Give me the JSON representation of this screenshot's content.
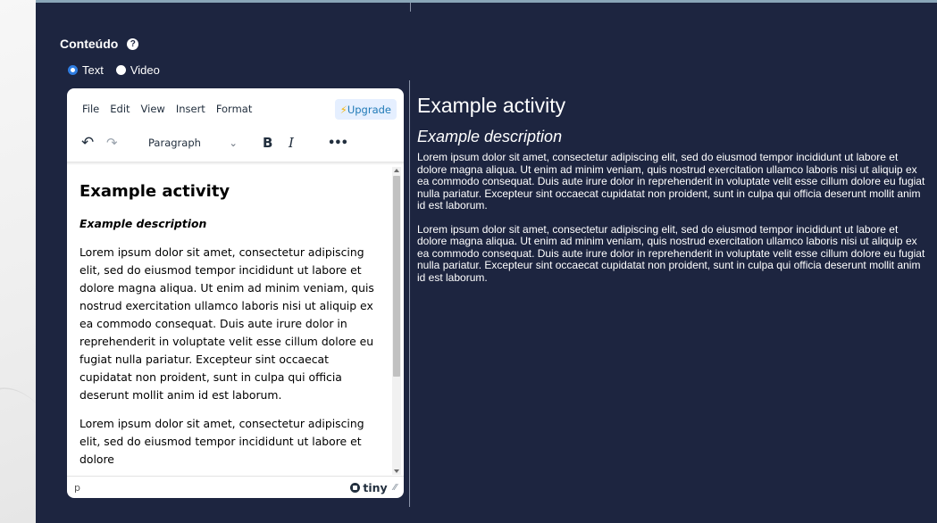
{
  "section": {
    "label": "Conteúdo",
    "help_icon": "question-circle-icon"
  },
  "content_type": {
    "options": [
      "Text",
      "Video"
    ],
    "selected": "Text"
  },
  "editor": {
    "menu": [
      "File",
      "Edit",
      "View",
      "Insert",
      "Format"
    ],
    "upgrade_label": "Upgrade",
    "block_format": "Paragraph",
    "bold_label": "B",
    "italic_label": "I",
    "more_label": "•••",
    "heading": "Example activity",
    "description": "Example description",
    "paragraphs": [
      "Lorem ipsum dolor sit amet, consectetur adipiscing elit, sed do eiusmod tempor incididunt ut labore et dolore magna aliqua. Ut enim ad minim veniam, quis nostrud exercitation ullamco laboris nisi ut aliquip ex ea commodo consequat. Duis aute irure dolor in reprehenderit in voluptate velit esse cillum dolore eu fugiat nulla pariatur. Excepteur sint occaecat cupidatat non proident, sunt in culpa qui officia deserunt mollit anim id est laborum.",
      "Lorem ipsum dolor sit amet, consectetur adipiscing elit, sed do eiusmod tempor incididunt ut labore et dolore"
    ],
    "status_path": "p",
    "brand": "tiny"
  },
  "preview": {
    "heading": "Example activity",
    "description": "Example description",
    "paragraphs": [
      "Lorem ipsum dolor sit amet, consectetur adipiscing elit, sed do eiusmod tempor incididunt ut labore et dolore magna aliqua. Ut enim ad minim veniam, quis nostrud exercitation ullamco laboris nisi ut aliquip ex ea commodo consequat. Duis aute irure dolor in reprehenderit in voluptate velit esse cillum dolore eu fugiat nulla pariatur. Excepteur sint occaecat cupidatat non proident, sunt in culpa qui officia deserunt mollit anim id est laborum.",
      "Lorem ipsum dolor sit amet, consectetur adipiscing elit, sed do eiusmod tempor incididunt ut labore et dolore magna aliqua. Ut enim ad minim veniam, quis nostrud exercitation ullamco laboris nisi ut aliquip ex ea commodo consequat. Duis aute irure dolor in reprehenderit in voluptate velit esse cillum dolore eu fugiat nulla pariatur. Excepteur sint occaecat cupidatat non proident, sunt in culpa qui officia deserunt mollit anim id est laborum."
    ]
  },
  "colors": {
    "panel_bg": "#1d2540",
    "accent": "#2f7de1",
    "upgrade_bg": "#e5efff",
    "upgrade_text": "#207ab7"
  }
}
